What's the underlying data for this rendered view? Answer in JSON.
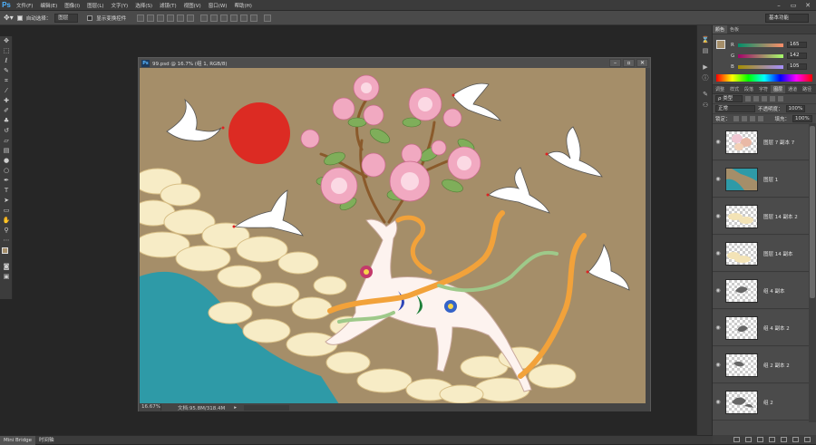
{
  "menubar": {
    "logo": "Ps",
    "items": [
      "文件(F)",
      "编辑(E)",
      "图像(I)",
      "图层(L)",
      "文字(Y)",
      "选择(S)",
      "滤镜(T)",
      "视图(V)",
      "窗口(W)",
      "帮助(H)"
    ],
    "window_controls": [
      "–",
      "▭",
      "✕"
    ]
  },
  "options_bar": {
    "auto_select_label": "自动选择：",
    "auto_select_value": "图层",
    "show_transform_label": "显示变换控件",
    "workspace": "基本功能"
  },
  "document": {
    "title": "99.psd @ 16.7% (组 1, RGB/8)",
    "zoom": "16.67%",
    "doc_info": "文档:95.8M/318.4M"
  },
  "bottom_tabs": [
    "Mini Bridge",
    "时间轴"
  ],
  "color_panel": {
    "tabs": [
      "颜色",
      "色板"
    ],
    "r_label": "R",
    "r": "165",
    "g_label": "G",
    "g": "142",
    "b_label": "B",
    "b": "105",
    "fg": "#a58e69"
  },
  "layers_panel": {
    "tabs": [
      "调整",
      "样式",
      "段落",
      "字符",
      "图层",
      "通道",
      "路径"
    ],
    "kind_filter": "ρ 类型",
    "blend_mode": "正常",
    "opacity_label": "不透明度：",
    "opacity": "100%",
    "lock_label": "锁定：",
    "fill_label": "填充：",
    "fill": "100%",
    "layers": [
      {
        "name": "图层 7 副本 7"
      },
      {
        "name": "图层 1"
      },
      {
        "name": "图层 14 副本 2"
      },
      {
        "name": "图层 14 副本"
      },
      {
        "name": "组 4 副本"
      },
      {
        "name": "组 4 副本 2"
      },
      {
        "name": "组 2 副本 2"
      },
      {
        "name": "组 2"
      }
    ]
  },
  "colors": {
    "art_background": "#a58e69",
    "sun": "#dc2b23",
    "water": "#2e9aa7",
    "cloud": "#f7ecc6"
  }
}
